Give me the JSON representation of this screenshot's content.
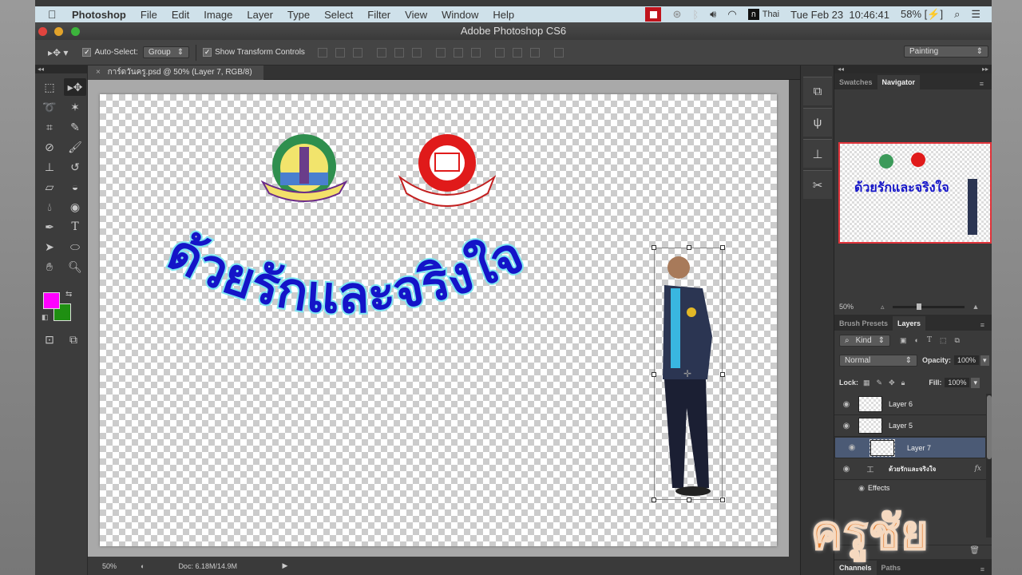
{
  "menubar": {
    "app": "Photoshop",
    "items": [
      "File",
      "Edit",
      "Image",
      "Layer",
      "Type",
      "Select",
      "Filter",
      "View",
      "Window",
      "Help"
    ],
    "status": {
      "input_source_badge": "ก",
      "input_source": "Thai",
      "date": "Tue Feb 23",
      "time": "10:46:41",
      "battery": "58%"
    }
  },
  "window": {
    "title": "Adobe Photoshop CS6"
  },
  "options_bar": {
    "auto_select_label": "Auto-Select:",
    "auto_select_checked": true,
    "auto_select_value": "Group",
    "show_transform_label": "Show Transform Controls",
    "show_transform_checked": true,
    "workspace": "Painting"
  },
  "document": {
    "tab_title": "การ์ดวันครู.psd @ 50% (Layer 7, RGB/8) *",
    "headline": "ด้วยรักและจริงใจ",
    "zoom": "50%",
    "doc_size": "Doc: 6.18M/14.9M"
  },
  "colors": {
    "foreground": "#ff00ff",
    "background": "#1f8f12",
    "headline": "#1414c8",
    "headline_glow": "#7fe4f0",
    "selection_frame": "#e0333a"
  },
  "navigator": {
    "tabs": [
      "Swatches",
      "Navigator"
    ],
    "active_tab": "Navigator",
    "zoom": "50%"
  },
  "layers_panel": {
    "tabs": [
      "Brush Presets",
      "Layers"
    ],
    "active_tab": "Layers",
    "filter": "Kind",
    "blend_mode": "Normal",
    "opacity_label": "Opacity:",
    "opacity": "100%",
    "lock_label": "Lock:",
    "fill_label": "Fill:",
    "fill": "100%",
    "layers": [
      {
        "name": "Layer 6",
        "selected": false
      },
      {
        "name": "Layer 5",
        "selected": false
      },
      {
        "name": "Layer 7",
        "selected": true
      },
      {
        "name": "ด้วยรักและจริงใจ",
        "selected": false,
        "type": "text",
        "fx": "fx"
      }
    ],
    "effects_label": "Effects"
  },
  "bottom_tabs": [
    "Channels",
    "Paths"
  ],
  "watermark": "ครูชัย"
}
